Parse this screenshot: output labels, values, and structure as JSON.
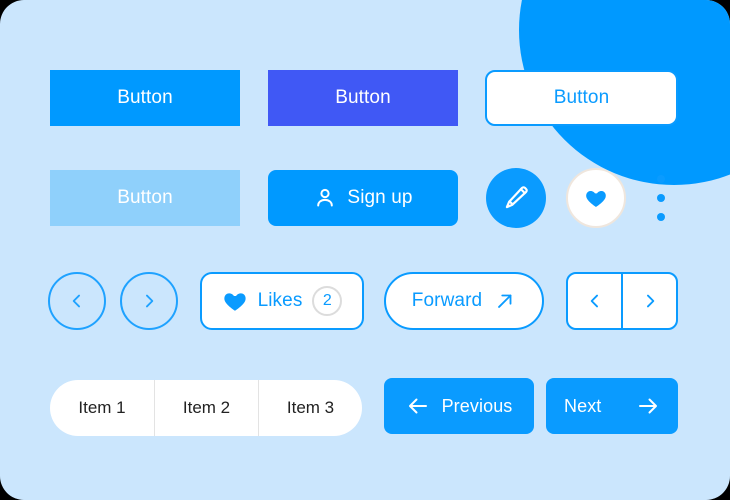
{
  "theme": {
    "page_background": "#cbe6fd",
    "primary_blue": "#0099ff",
    "accent_blue": "#0a9bff",
    "indigo": "#4058f5",
    "disabled_blue": "#8fd0fb",
    "white": "#ffffff",
    "badge_ring": "#dcdcdc",
    "heart_ring": "#efe6dd",
    "segment_divider": "#e3e3e3",
    "segment_text": "#222222"
  },
  "decor": {
    "blob_name": "blue-circle-decoration",
    "blob_color": "#0099ff"
  },
  "row1": {
    "primary_button": {
      "label": "Button",
      "icon": ""
    },
    "indigo_button": {
      "label": "Button",
      "icon": ""
    },
    "outline_button": {
      "label": "Button",
      "icon": ""
    }
  },
  "row2": {
    "disabled_button": {
      "label": "Button"
    },
    "signup_button": {
      "label": "Sign up",
      "icon": "user-icon"
    },
    "edit_button": {
      "icon": "pencil-icon"
    },
    "favorite_button": {
      "icon": "heart-icon"
    },
    "more_button": {
      "icon": "three-dots-vertical-icon"
    }
  },
  "row3": {
    "circle_prev": {
      "icon": "chevron-left-icon"
    },
    "circle_next": {
      "icon": "chevron-right-icon"
    },
    "likes_button": {
      "label": "Likes",
      "icon": "heart-icon",
      "count": "2"
    },
    "forward_button": {
      "label": "Forward",
      "icon": "arrow-up-right-icon"
    },
    "split_prev": {
      "icon": "chevron-left-icon"
    },
    "split_next": {
      "icon": "chevron-right-icon"
    }
  },
  "row4": {
    "segments": [
      {
        "label": "Item 1"
      },
      {
        "label": "Item 2"
      },
      {
        "label": "Item 3"
      }
    ],
    "previous_button": {
      "label": "Previous",
      "icon": "arrow-left-icon"
    },
    "next_button": {
      "label": "Next",
      "icon": "arrow-right-icon"
    }
  }
}
